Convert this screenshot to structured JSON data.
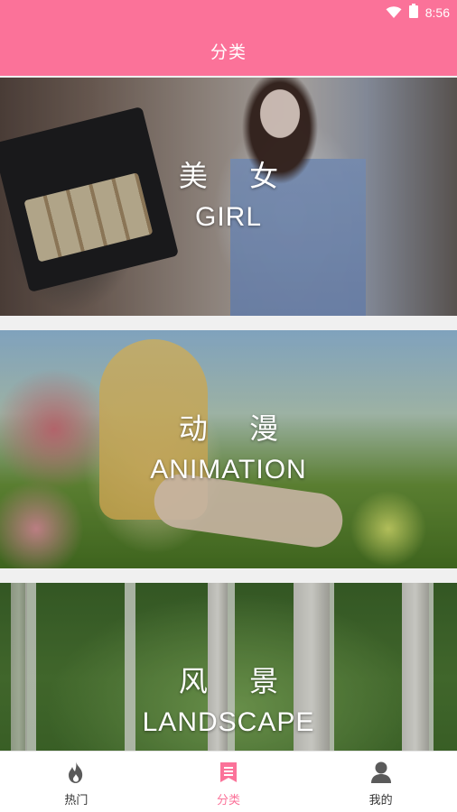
{
  "status_bar": {
    "time": "8:56"
  },
  "app_bar": {
    "title": "分类"
  },
  "categories": [
    {
      "cn": "美 女",
      "en": "GIRL"
    },
    {
      "cn": "动 漫",
      "en": "ANIMATION"
    },
    {
      "cn": "风 景",
      "en": "LANDSCAPE"
    }
  ],
  "bottom_nav": {
    "items": [
      {
        "label": "热门",
        "icon": "flame-icon",
        "active": false
      },
      {
        "label": "分类",
        "icon": "bookmark-list-icon",
        "active": true
      },
      {
        "label": "我的",
        "icon": "user-icon",
        "active": false
      }
    ]
  },
  "colors": {
    "accent": "#fb7299",
    "inactive_icon": "#5a5a5a"
  }
}
